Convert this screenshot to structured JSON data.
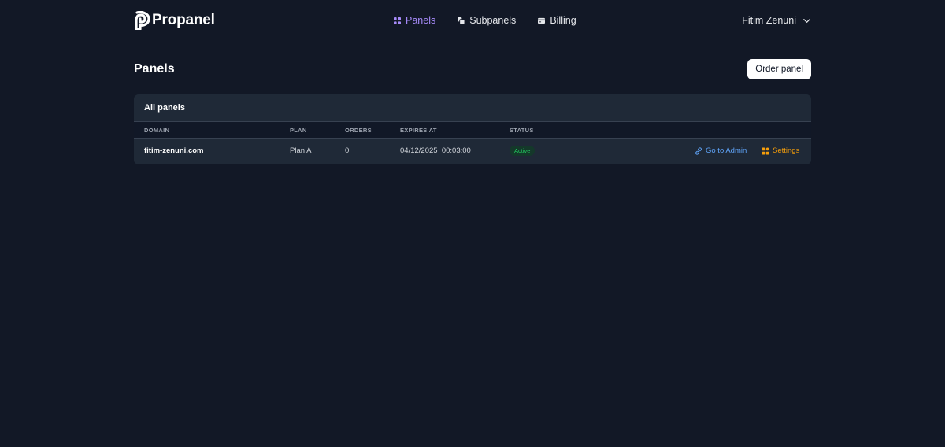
{
  "brand": {
    "name": "Propanel",
    "icon": "propanel-logo"
  },
  "nav": {
    "items": [
      {
        "label": "Panels",
        "icon": "grid-icon",
        "active": true
      },
      {
        "label": "Subpanels",
        "icon": "stack-icon",
        "active": false
      },
      {
        "label": "Billing",
        "icon": "card-icon",
        "active": false
      }
    ]
  },
  "user": {
    "name": "Fitim Zenuni",
    "icon": "chevron-down-icon"
  },
  "page": {
    "title": "Panels",
    "order_button": "Order panel"
  },
  "table": {
    "title": "All panels",
    "columns": [
      "DOMAIN",
      "PLAN",
      "ORDERS",
      "EXPIRES AT",
      "STATUS"
    ],
    "rows": [
      {
        "domain": "fitim-zenuni.com",
        "plan": "Plan A",
        "orders": "0",
        "expires": "04/12/2025  00:03:00",
        "status": "Active",
        "go_admin": "Go to Admin",
        "settings": "Settings"
      }
    ]
  },
  "colors": {
    "background": "#121826",
    "card": "#1f2937",
    "accent": "#a78bfa",
    "link": "#60a5fa",
    "settings": "#f59e0b",
    "active_badge": "#22c55e"
  }
}
